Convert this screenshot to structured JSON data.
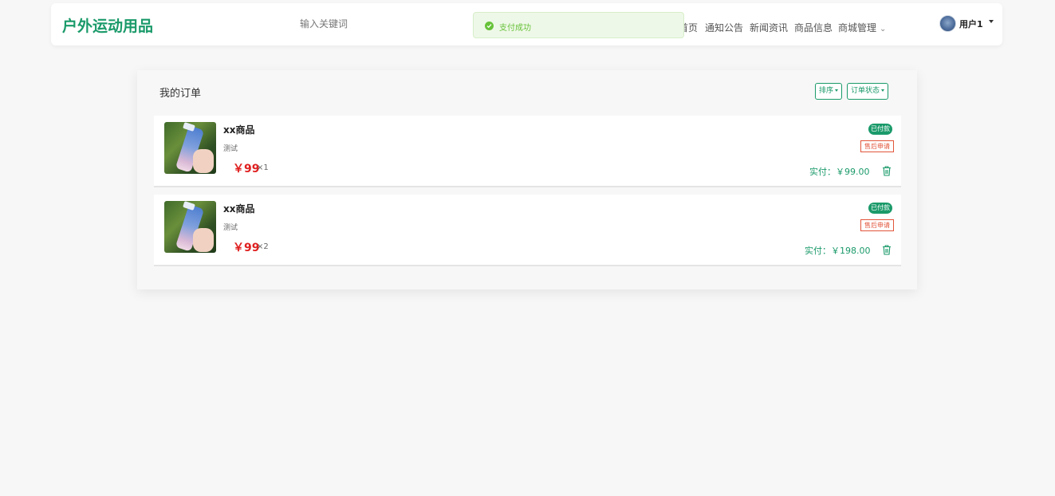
{
  "header": {
    "logo": "户外运动用品",
    "search_placeholder": "输入关键词",
    "nav": [
      {
        "label": "首页"
      },
      {
        "label": "通知公告"
      },
      {
        "label": "新闻资讯"
      },
      {
        "label": "商品信息"
      },
      {
        "label": "商城管理"
      }
    ],
    "user": {
      "name": "用户1"
    }
  },
  "toast": {
    "text": "支付成功",
    "color": "#67c23a"
  },
  "orders_panel": {
    "title": "我的订单",
    "sort_label": "排序",
    "status_label": "订单状态",
    "orders": [
      {
        "name": "xx商品",
        "desc": "测试",
        "price": "￥99",
        "qty": "×1",
        "status": "已付款",
        "after_sale": "售后申请",
        "paid": "实付：￥99.00"
      },
      {
        "name": "xx商品",
        "desc": "测试",
        "price": "￥99",
        "qty": "×2",
        "status": "已付款",
        "after_sale": "售后申请",
        "paid": "实付：￥198.00"
      }
    ]
  },
  "colors": {
    "accent": "#1a9a6a",
    "price": "#e02020",
    "after_sale": "#e2553b"
  }
}
